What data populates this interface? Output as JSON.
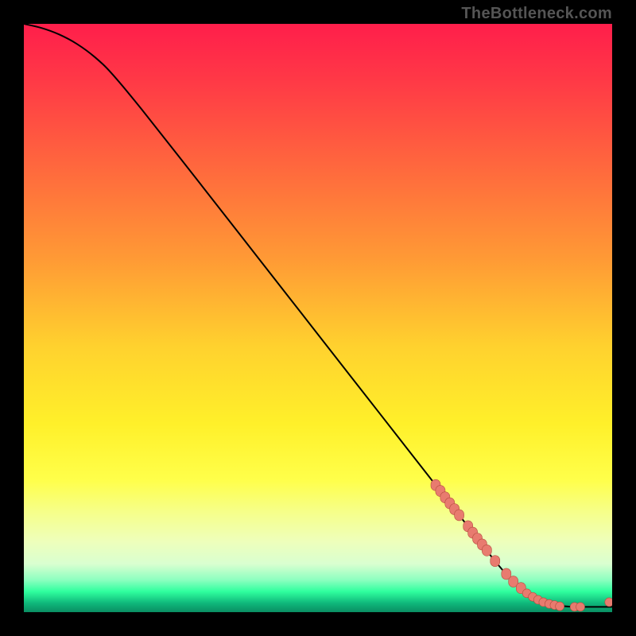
{
  "watermark": "TheBottleneck.com",
  "accent": {
    "curve_stroke": "#000000",
    "point_fill": "#e87b6f",
    "point_stroke": "#b54d3f"
  },
  "gradient_stops": [
    {
      "offset": 0.0,
      "color": "#ff1e4b"
    },
    {
      "offset": 0.1,
      "color": "#ff3a46"
    },
    {
      "offset": 0.25,
      "color": "#ff6a3d"
    },
    {
      "offset": 0.4,
      "color": "#ff9a35"
    },
    {
      "offset": 0.55,
      "color": "#ffd22e"
    },
    {
      "offset": 0.68,
      "color": "#fff02a"
    },
    {
      "offset": 0.775,
      "color": "#ffff4a"
    },
    {
      "offset": 0.83,
      "color": "#f6ff8a"
    },
    {
      "offset": 0.88,
      "color": "#eeffbb"
    },
    {
      "offset": 0.918,
      "color": "#d9ffd0"
    },
    {
      "offset": 0.945,
      "color": "#8dffc0"
    },
    {
      "offset": 0.965,
      "color": "#2fff9e"
    },
    {
      "offset": 0.985,
      "color": "#0fb77a"
    },
    {
      "offset": 1.0,
      "color": "#0a8f63"
    }
  ],
  "chart_data": {
    "type": "line",
    "title": "",
    "xlabel": "",
    "ylabel": "",
    "xlim": [
      0,
      100
    ],
    "ylim": [
      0,
      100
    ],
    "curve": [
      {
        "x": 0,
        "y": 100
      },
      {
        "x": 3,
        "y": 99.3
      },
      {
        "x": 6,
        "y": 98.2
      },
      {
        "x": 9,
        "y": 96.6
      },
      {
        "x": 12,
        "y": 94.4
      },
      {
        "x": 15,
        "y": 91.5
      },
      {
        "x": 20,
        "y": 85.5
      },
      {
        "x": 30,
        "y": 72.8
      },
      {
        "x": 40,
        "y": 60.0
      },
      {
        "x": 50,
        "y": 47.2
      },
      {
        "x": 60,
        "y": 34.4
      },
      {
        "x": 70,
        "y": 21.6
      },
      {
        "x": 75,
        "y": 15.2
      },
      {
        "x": 80,
        "y": 8.8
      },
      {
        "x": 83,
        "y": 5.4
      },
      {
        "x": 86,
        "y": 3.0
      },
      {
        "x": 89,
        "y": 1.6
      },
      {
        "x": 92,
        "y": 1.0
      },
      {
        "x": 95,
        "y": 0.9
      },
      {
        "x": 100,
        "y": 0.9
      }
    ],
    "points_segment": [
      {
        "x": 70.0,
        "y": 21.6
      },
      {
        "x": 70.8,
        "y": 20.6
      },
      {
        "x": 71.6,
        "y": 19.5
      },
      {
        "x": 72.4,
        "y": 18.5
      },
      {
        "x": 73.2,
        "y": 17.5
      },
      {
        "x": 74.0,
        "y": 16.5
      },
      {
        "x": 75.5,
        "y": 14.6
      },
      {
        "x": 76.3,
        "y": 13.5
      },
      {
        "x": 77.1,
        "y": 12.5
      },
      {
        "x": 77.9,
        "y": 11.5
      },
      {
        "x": 78.7,
        "y": 10.5
      },
      {
        "x": 80.1,
        "y": 8.7
      },
      {
        "x": 82.0,
        "y": 6.5
      },
      {
        "x": 83.2,
        "y": 5.2
      },
      {
        "x": 84.5,
        "y": 4.1
      }
    ],
    "points_bottom": [
      {
        "x": 85.5,
        "y": 3.2
      },
      {
        "x": 86.5,
        "y": 2.6
      },
      {
        "x": 87.4,
        "y": 2.1
      },
      {
        "x": 88.3,
        "y": 1.7
      },
      {
        "x": 89.3,
        "y": 1.4
      },
      {
        "x": 90.2,
        "y": 1.2
      },
      {
        "x": 91.1,
        "y": 1.0
      },
      {
        "x": 93.6,
        "y": 0.9
      },
      {
        "x": 94.6,
        "y": 0.9
      },
      {
        "x": 99.5,
        "y": 1.7
      }
    ]
  }
}
